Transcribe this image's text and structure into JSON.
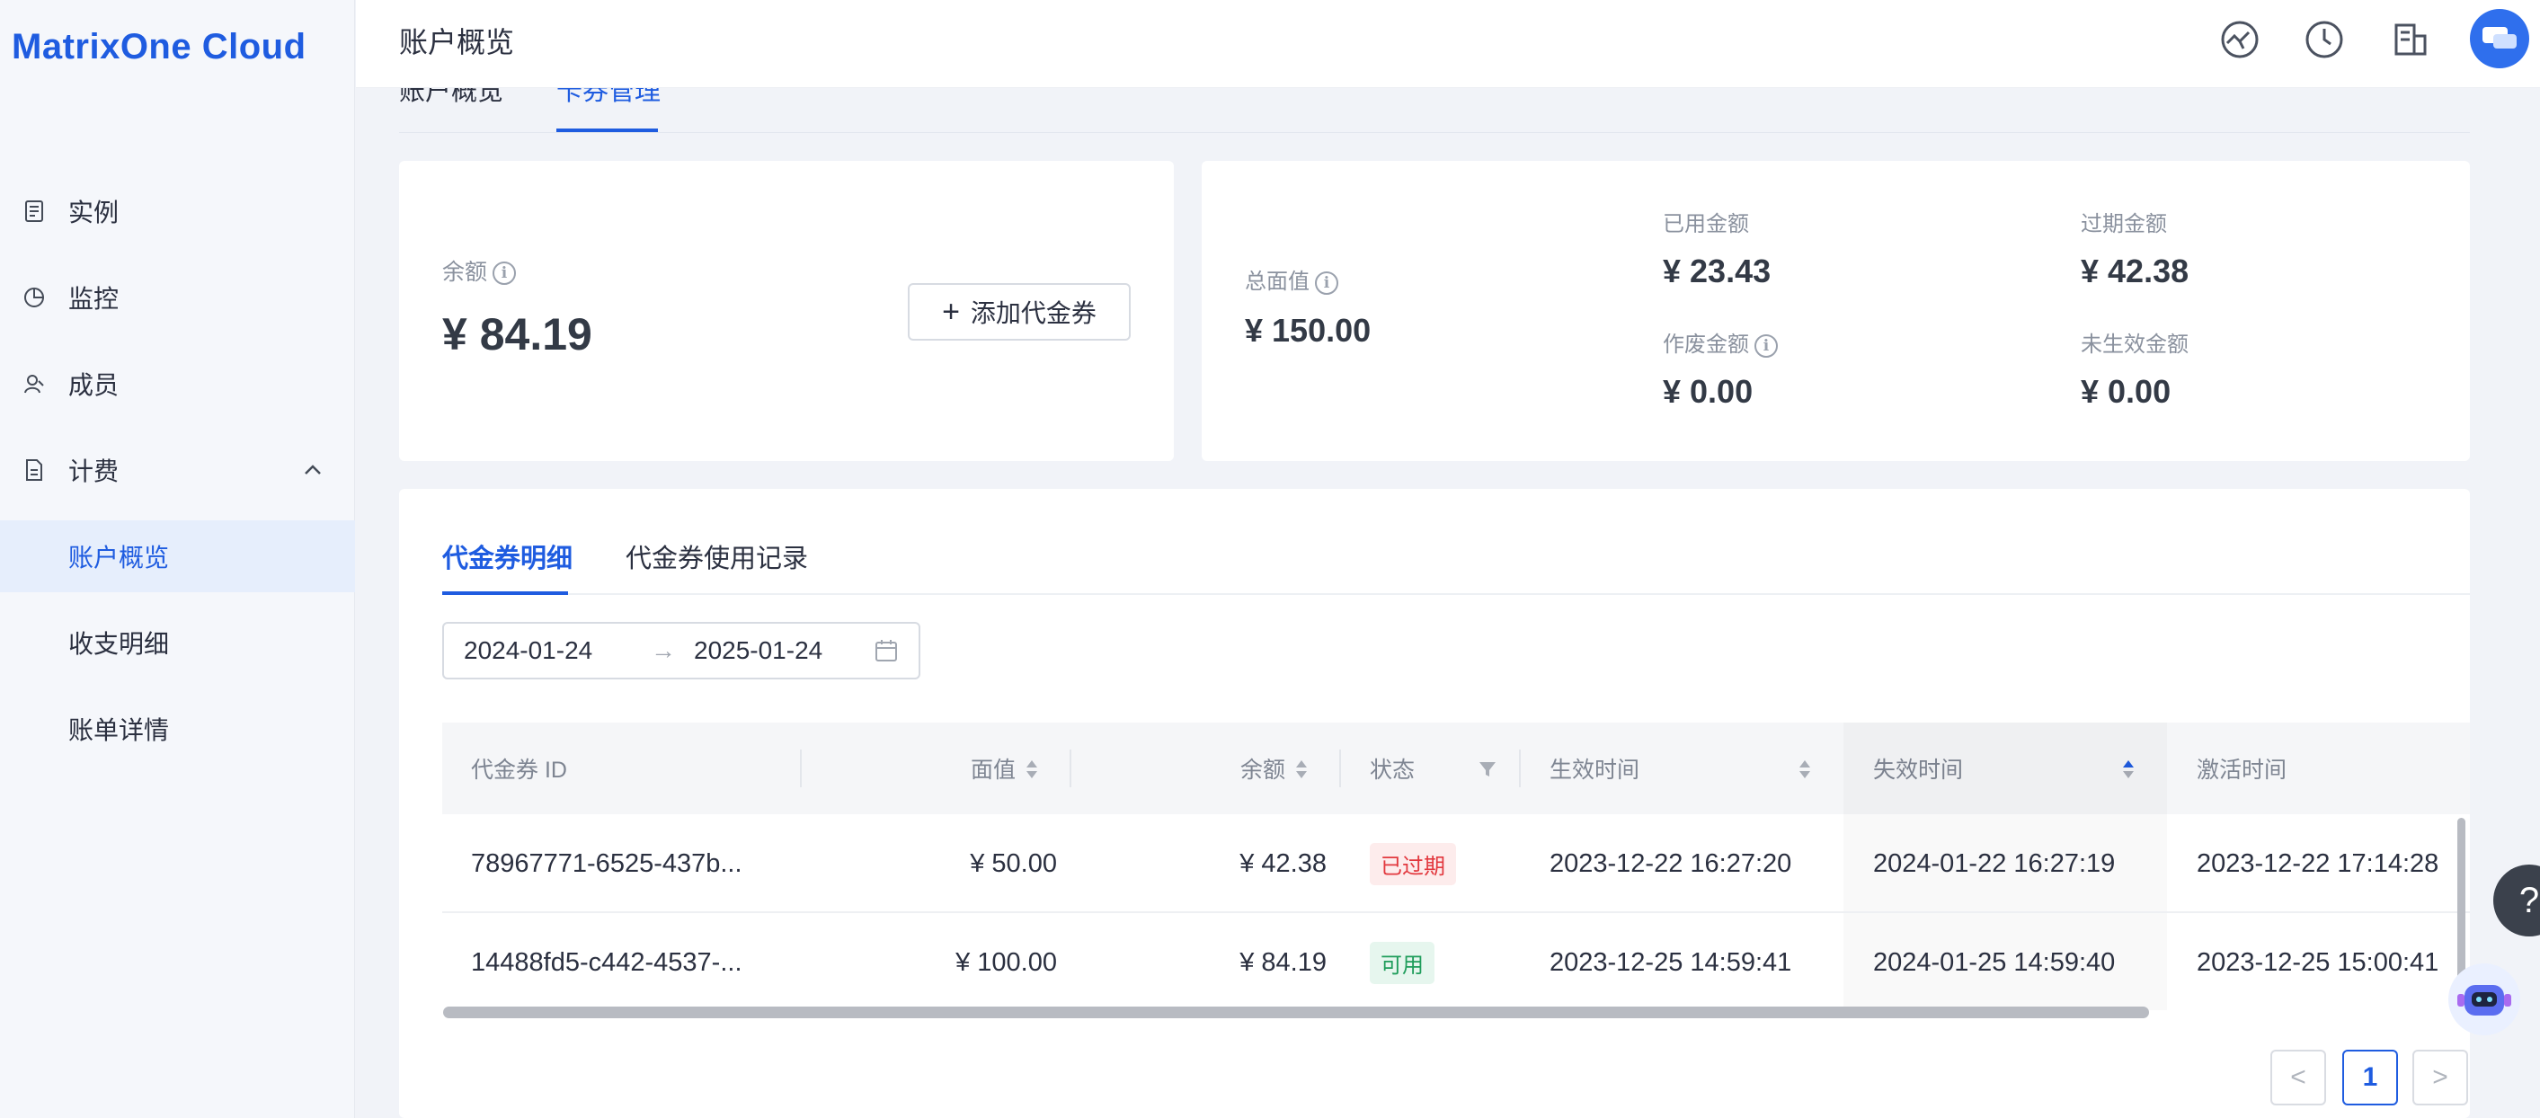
{
  "app": {
    "logo_text": "MatrixOne Cloud"
  },
  "sidebar": {
    "items": [
      {
        "label": "实例",
        "icon": "instance-icon"
      },
      {
        "label": "监控",
        "icon": "monitor-icon"
      },
      {
        "label": "成员",
        "icon": "members-icon"
      },
      {
        "label": "计费",
        "icon": "billing-icon"
      }
    ],
    "billing_sub": [
      {
        "label": "账户概览",
        "active": true
      },
      {
        "label": "收支明细",
        "active": false
      },
      {
        "label": "账单详情",
        "active": false
      }
    ]
  },
  "header": {
    "title": "账户概览",
    "icons": [
      "dashboard-icon",
      "clock-icon",
      "building-icon",
      "avatar"
    ]
  },
  "top_tabs": [
    "账户概览",
    "卡券管理"
  ],
  "balance_card": {
    "label": "余额",
    "value": "¥ 84.19",
    "add_button": "添加代金券"
  },
  "totals": {
    "total_label": "总面值",
    "total_value": "¥ 150.00",
    "used_label": "已用金额",
    "used_value": "¥ 23.43",
    "expired_label": "过期金额",
    "expired_value": "¥ 42.38",
    "void_label": "作废金额",
    "void_value": "¥ 0.00",
    "pending_label": "未生效金额",
    "pending_value": "¥ 0.00"
  },
  "detail_tabs": [
    "代金券明细",
    "代金券使用记录"
  ],
  "date_range": {
    "start": "2024-01-24",
    "end": "2025-01-24"
  },
  "table": {
    "columns": [
      "代金券 ID",
      "面值",
      "余额",
      "状态",
      "生效时间",
      "失效时间",
      "激活时间"
    ],
    "rows": [
      {
        "id": "78967771-6525-437b...",
        "face": "¥ 50.00",
        "balance": "¥ 42.38",
        "status": "已过期",
        "effective": "2023-12-22 16:27:20",
        "expire": "2024-01-22 16:27:19",
        "activate": "2023-12-22 17:14:28"
      },
      {
        "id": "14488fd5-c442-4537-...",
        "face": "¥ 100.00",
        "balance": "¥ 84.19",
        "status": "可用",
        "effective": "2023-12-25 14:59:41",
        "expire": "2024-01-25 14:59:40",
        "activate": "2023-12-25 15:00:41"
      }
    ]
  },
  "pagination": {
    "prev": "<",
    "current": "1",
    "next": ">"
  },
  "help": {
    "label": "?"
  },
  "colors": {
    "accent": "#1f5ce0",
    "expired": "#e2383e",
    "available": "#1f9d5b"
  }
}
